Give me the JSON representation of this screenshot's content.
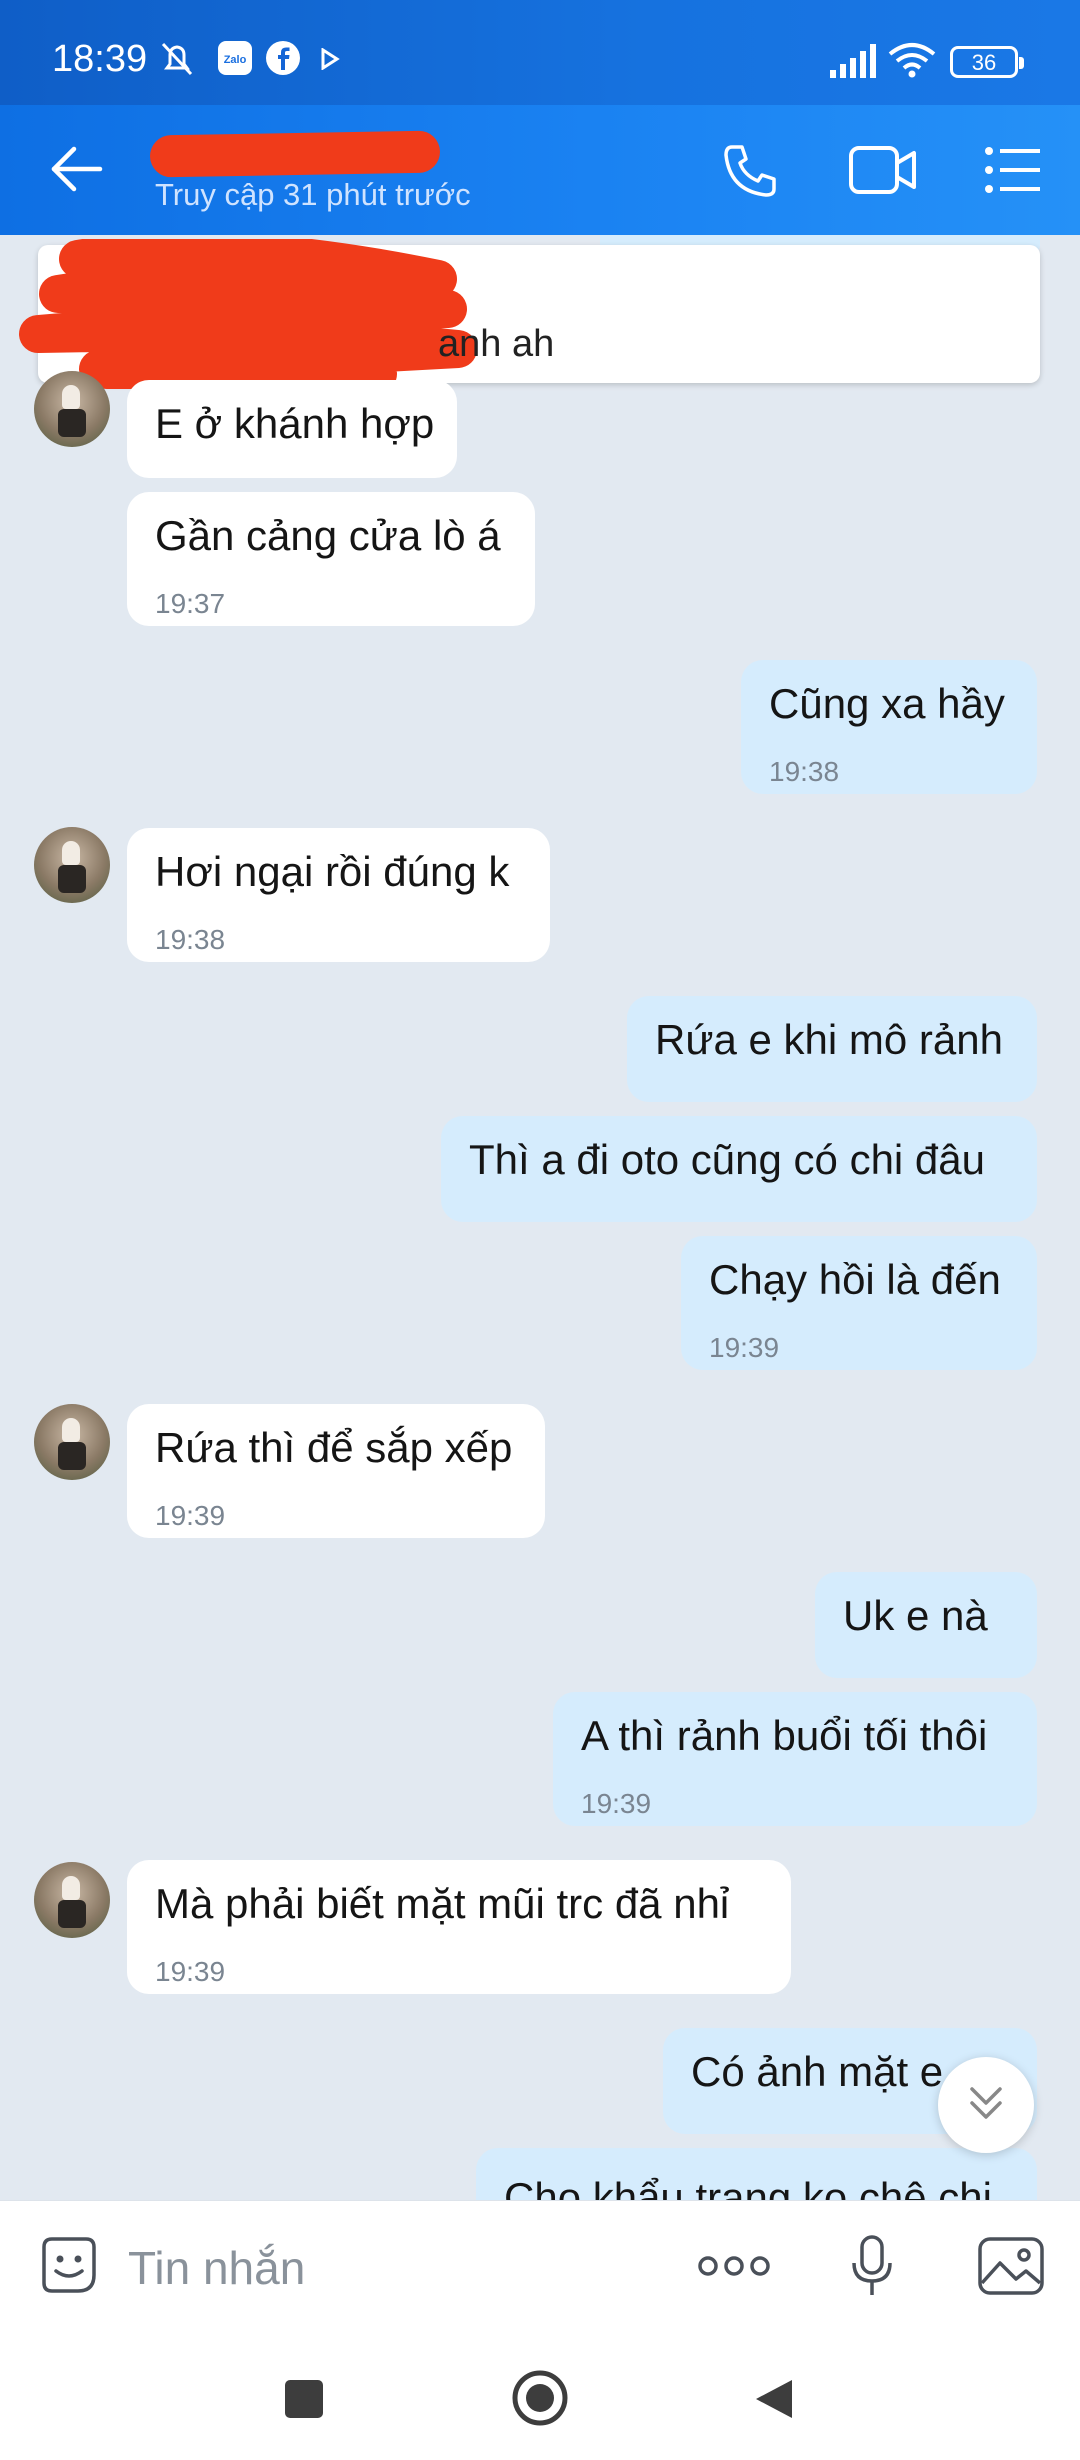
{
  "status_bar": {
    "time": "18:39",
    "battery": "36",
    "icons": [
      "mute-icon",
      "zalo-icon",
      "facebook-icon",
      "play-icon",
      "signal-icon",
      "wifi-icon",
      "battery-icon"
    ]
  },
  "header": {
    "subtitle": "Truy cập 31 phút trước",
    "icons": [
      "back-icon",
      "call-icon",
      "video-icon",
      "menu-icon"
    ]
  },
  "pinned": {
    "text_fragment": "anh ah"
  },
  "messages": [
    {
      "dir": "in",
      "text": "E ở khánh hợp",
      "time": ""
    },
    {
      "dir": "in",
      "text": "Gần cảng cửa lò á",
      "time": "19:37"
    },
    {
      "dir": "out",
      "text": "Cũng xa hầy",
      "time": "19:38"
    },
    {
      "dir": "in",
      "text": "Hơi ngại rồi đúng k",
      "time": "19:38"
    },
    {
      "dir": "out",
      "text": "Rứa e khi mô rảnh",
      "time": ""
    },
    {
      "dir": "out",
      "text": "Thì a đi oto cũng có chi đâu",
      "time": ""
    },
    {
      "dir": "out",
      "text": "Chạy hồi là đến",
      "time": "19:39"
    },
    {
      "dir": "in",
      "text": "Rứa thì để sắp xếp",
      "time": "19:39"
    },
    {
      "dir": "out",
      "text": "Uk e nà",
      "time": ""
    },
    {
      "dir": "out",
      "text": "A thì rảnh buổi tối thôi",
      "time": "19:39"
    },
    {
      "dir": "in",
      "text": "Mà phải biết mặt mũi trc đã nhỉ",
      "time": "19:39"
    },
    {
      "dir": "out",
      "text": "Có ảnh mặt e",
      "time": ""
    },
    {
      "dir": "out",
      "text": "Cho khẩu trang ko chê chi",
      "time": ""
    }
  ],
  "input": {
    "placeholder": "Tin nhắn"
  }
}
